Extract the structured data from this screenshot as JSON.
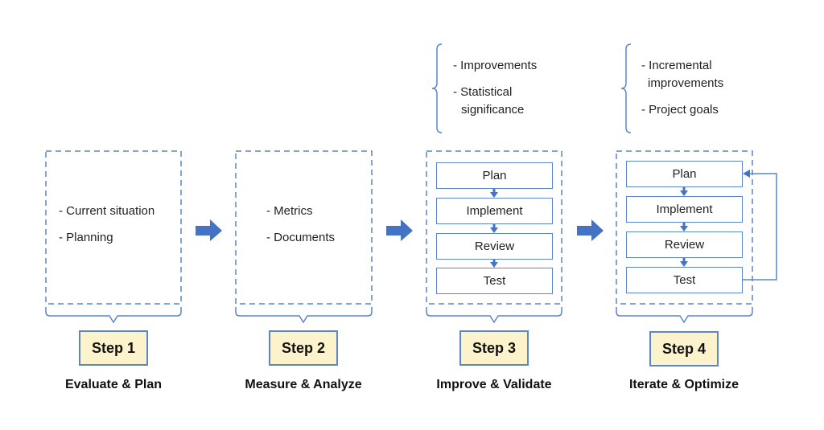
{
  "colors": {
    "accent": "#4472c4",
    "line": "#5b86c9",
    "step_fill": "#fcf2cc"
  },
  "steps": [
    {
      "label": "Step 1",
      "title": "Evaluate & Plan",
      "items": [
        "- Current situation",
        "- Planning"
      ]
    },
    {
      "label": "Step 2",
      "title": "Measure & Analyze",
      "items": [
        "- Metrics",
        "- Documents"
      ]
    },
    {
      "label": "Step 3",
      "title": "Improve & Validate",
      "cycle": [
        "Plan",
        "Implement",
        "Review",
        "Test"
      ],
      "notes": [
        "- Improvements",
        "- Statistical",
        "significance"
      ]
    },
    {
      "label": "Step 4",
      "title": "Iterate & Optimize",
      "cycle": [
        "Plan",
        "Implement",
        "Review",
        "Test"
      ],
      "notes": [
        "- Incremental",
        "improvements",
        "- Project goals"
      ]
    }
  ]
}
